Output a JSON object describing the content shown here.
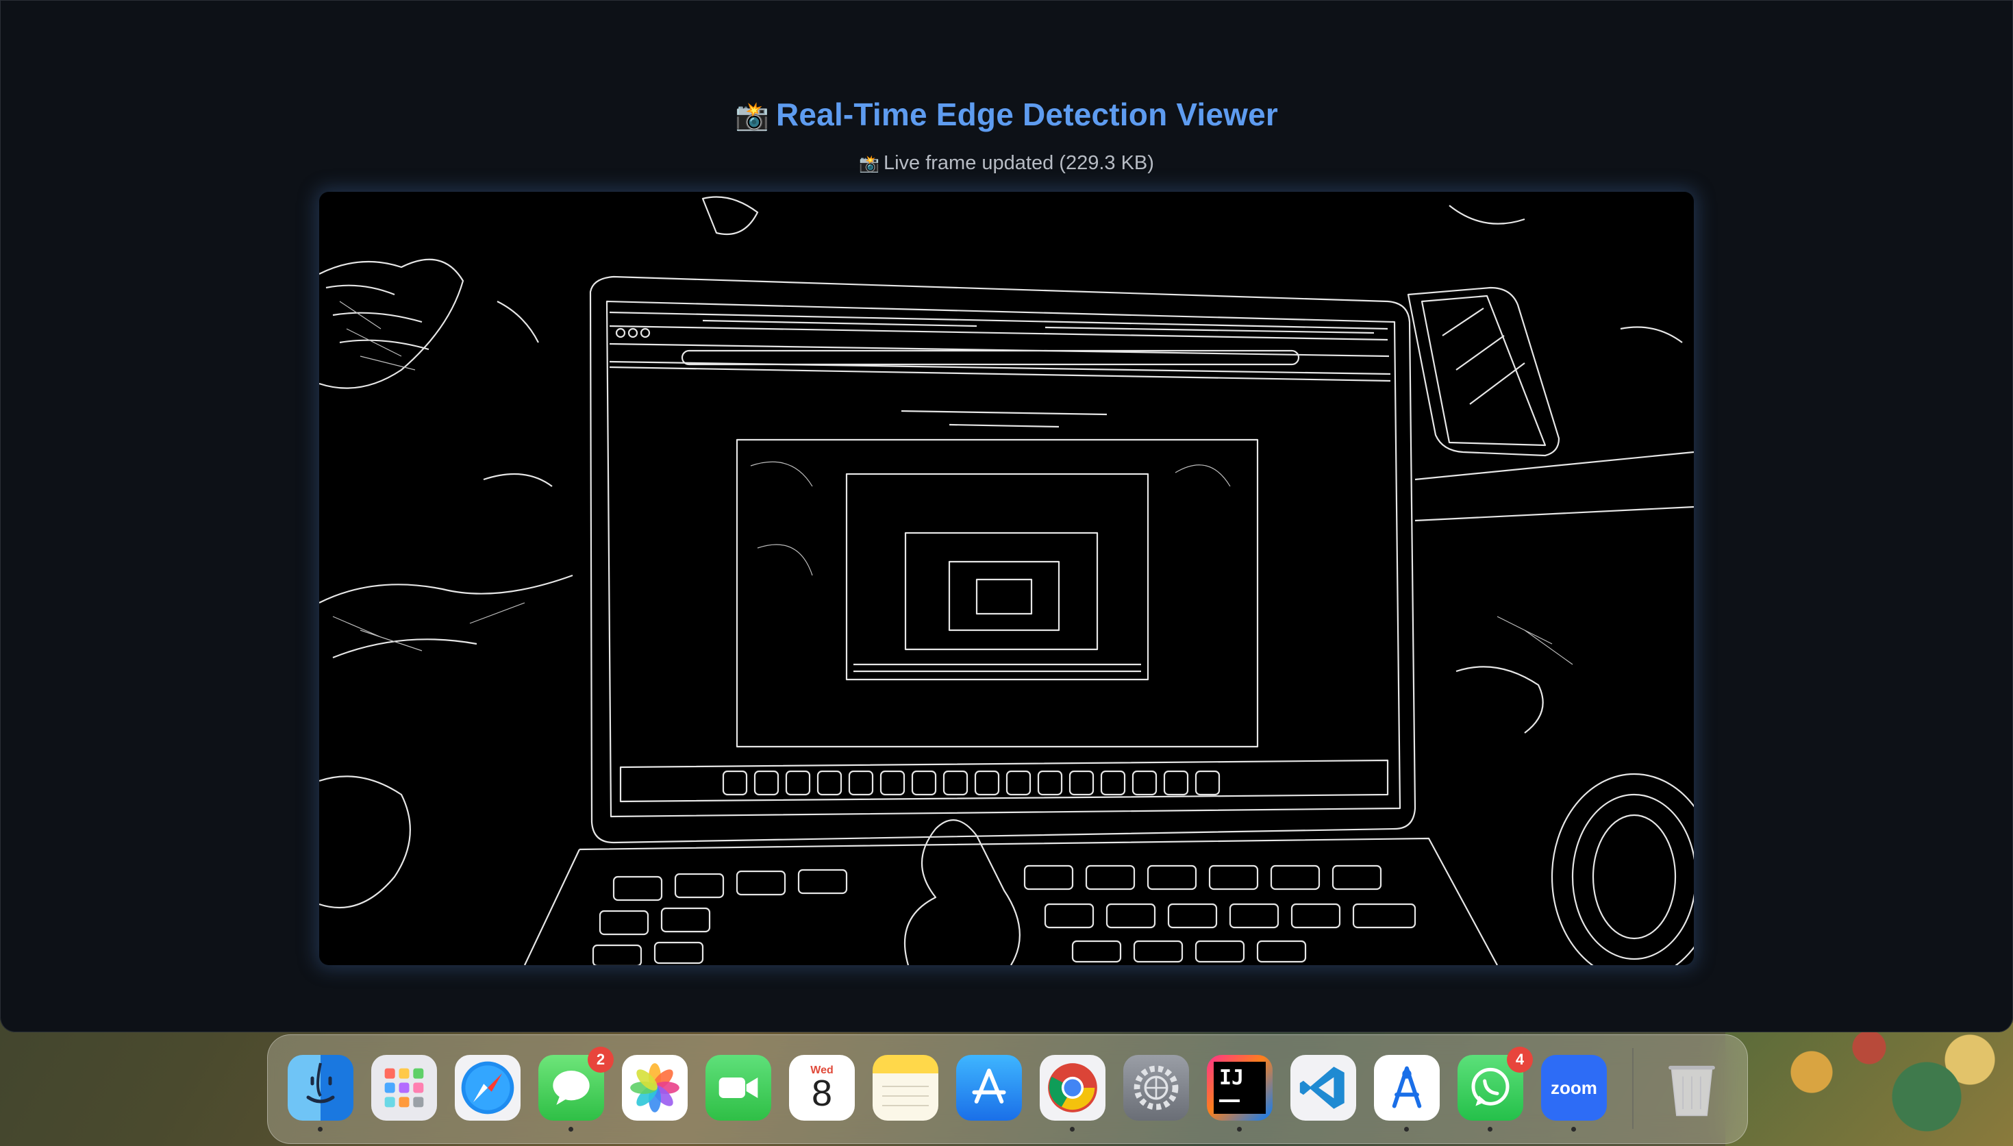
{
  "page": {
    "title_icon": "📸",
    "title": "Real-Time Edge Detection Viewer",
    "status_icon": "📸",
    "status_text": "Live frame updated (229.3 KB)"
  },
  "dock": {
    "apps": [
      {
        "name": "Finder",
        "icon": "finder-icon",
        "running": true
      },
      {
        "name": "Launchpad",
        "icon": "launchpad-icon",
        "running": false
      },
      {
        "name": "Safari",
        "icon": "safari-icon",
        "running": false
      },
      {
        "name": "Messages",
        "icon": "messages-icon",
        "running": true,
        "badge": "2"
      },
      {
        "name": "Photos",
        "icon": "photos-icon",
        "running": false
      },
      {
        "name": "FaceTime",
        "icon": "facetime-icon",
        "running": false
      },
      {
        "name": "Calendar",
        "icon": "calendar-icon",
        "running": false,
        "day": "Wed",
        "date": "8"
      },
      {
        "name": "Notes",
        "icon": "notes-icon",
        "running": false
      },
      {
        "name": "App Store",
        "icon": "app-store-icon",
        "running": false
      },
      {
        "name": "Chrome",
        "icon": "chrome-icon",
        "running": true
      },
      {
        "name": "System Settings",
        "icon": "settings-icon",
        "running": false
      },
      {
        "name": "IntelliJ IDEA",
        "icon": "intellij-icon",
        "running": true,
        "label": "IJ"
      },
      {
        "name": "Visual Studio Code",
        "icon": "vscode-icon",
        "running": false
      },
      {
        "name": "Instruments",
        "icon": "instruments-icon",
        "running": true
      },
      {
        "name": "WhatsApp",
        "icon": "whatsapp-icon",
        "running": true,
        "badge": "4"
      },
      {
        "name": "Zoom",
        "icon": "zoom-icon",
        "running": true,
        "label": "zoom"
      },
      {
        "name": "Trash",
        "icon": "trash-icon",
        "running": false
      }
    ]
  },
  "colors": {
    "page_bg": "#0d1117",
    "title": "#5e9cf0",
    "status": "#b7bcc4",
    "badge": "#e8453c"
  }
}
